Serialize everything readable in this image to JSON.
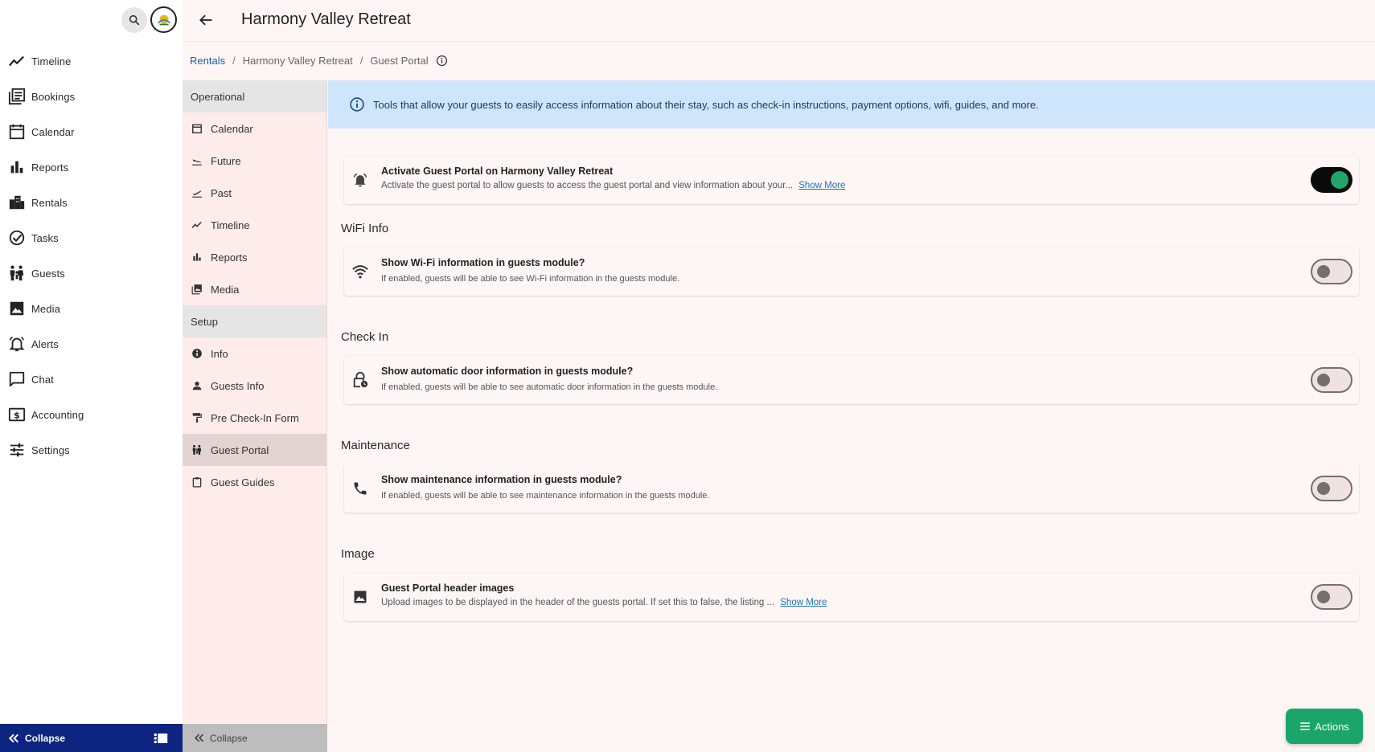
{
  "app": {
    "title": "Harmony Valley Retreat"
  },
  "sidebar": {
    "items": [
      {
        "label": "Timeline",
        "icon": "timeline-icon"
      },
      {
        "label": "Bookings",
        "icon": "bookings-icon"
      },
      {
        "label": "Calendar",
        "icon": "calendar-icon"
      },
      {
        "label": "Reports",
        "icon": "reports-icon"
      },
      {
        "label": "Rentals",
        "icon": "rentals-icon"
      },
      {
        "label": "Tasks",
        "icon": "tasks-icon"
      },
      {
        "label": "Guests",
        "icon": "guests-icon"
      },
      {
        "label": "Media",
        "icon": "media-icon"
      },
      {
        "label": "Alerts",
        "icon": "alerts-icon"
      },
      {
        "label": "Chat",
        "icon": "chat-icon"
      },
      {
        "label": "Accounting",
        "icon": "accounting-icon"
      },
      {
        "label": "Settings",
        "icon": "settings-icon"
      }
    ],
    "collapse_label": "Collapse"
  },
  "breadcrumb": {
    "root": "Rentals",
    "parent": "Harmony Valley Retreat",
    "current": "Guest Portal"
  },
  "subnav": {
    "operational_label": "Operational",
    "operational": [
      {
        "label": "Calendar",
        "icon": "calendar-icon"
      },
      {
        "label": "Future",
        "icon": "flight-land-icon"
      },
      {
        "label": "Past",
        "icon": "flight-takeoff-icon"
      },
      {
        "label": "Timeline",
        "icon": "timeline-icon"
      },
      {
        "label": "Reports",
        "icon": "reports-icon"
      },
      {
        "label": "Media",
        "icon": "media-icon"
      }
    ],
    "setup_label": "Setup",
    "setup": [
      {
        "label": "Info",
        "icon": "info-icon"
      },
      {
        "label": "Guests Info",
        "icon": "person-icon"
      },
      {
        "label": "Pre Check-In Form",
        "icon": "paint-roller-icon"
      },
      {
        "label": "Guest Portal",
        "icon": "family-icon"
      },
      {
        "label": "Guest Guides",
        "icon": "clipboard-icon"
      }
    ],
    "collapse_label": "Collapse"
  },
  "banner": {
    "text": "Tools that allow your guests to easily access information about their stay, such as check-in instructions, payment options, wifi, guides, and more."
  },
  "sections": {
    "wifi": "WiFi Info",
    "checkin": "Check In",
    "maintenance": "Maintenance",
    "image": "Image"
  },
  "cards": {
    "activate": {
      "title": "Activate Guest Portal on Harmony Valley Retreat",
      "desc": "Activate the guest portal to allow guests to access the guest portal and view information about your...",
      "more": "Show More",
      "enabled": true
    },
    "wifi": {
      "title": "Show Wi-Fi information in guests module?",
      "desc": "If enabled, guests will be able to see Wi-Fi information in the guests module.",
      "enabled": false
    },
    "door": {
      "title": "Show automatic door information in guests module?",
      "desc": "If enabled, guests will be able to see automatic door information in the guests module.",
      "enabled": false
    },
    "maintenance": {
      "title": "Show maintenance information in guests module?",
      "desc": "If enabled, guests will be able to see maintenance information in the guests module.",
      "enabled": false
    },
    "images": {
      "title": "Guest Portal header images",
      "desc": "Upload images to be displayed in the header of the guests portal. If set this to false, the listing ...",
      "more": "Show More",
      "enabled": false
    }
  },
  "actions": {
    "label": "Actions"
  },
  "colors": {
    "accent": "#1ba56b",
    "link": "#1a73c8",
    "nav_dark": "#0d2481",
    "banner_bg": "#cfe5fb"
  }
}
